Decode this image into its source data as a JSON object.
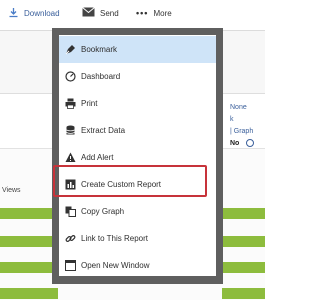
{
  "toolbar": {
    "download_label": "Download",
    "send_label": "Send",
    "more_label": "More"
  },
  "background": {
    "views_label": "Views",
    "side_none": "None",
    "side_graph": "| Graph",
    "side_no": "No"
  },
  "menu": {
    "items": [
      {
        "label": "Bookmark",
        "icon": "bookmark-icon"
      },
      {
        "label": "Dashboard",
        "icon": "dashboard-icon"
      },
      {
        "label": "Print",
        "icon": "print-icon"
      },
      {
        "label": "Extract Data",
        "icon": "database-icon"
      },
      {
        "label": "Add Alert",
        "icon": "alert-icon"
      },
      {
        "label": "Create Custom Report",
        "icon": "report-icon"
      },
      {
        "label": "Copy Graph",
        "icon": "copy-icon"
      },
      {
        "label": "Link to This Report",
        "icon": "link-icon"
      },
      {
        "label": "Open New Window",
        "icon": "window-icon"
      }
    ]
  },
  "colors": {
    "accent": "#3a5f9b",
    "menu_frame": "#5f5f5f",
    "selected": "#cfe4f8",
    "highlight": "#c7333a",
    "bar": "#8dbc3d"
  }
}
